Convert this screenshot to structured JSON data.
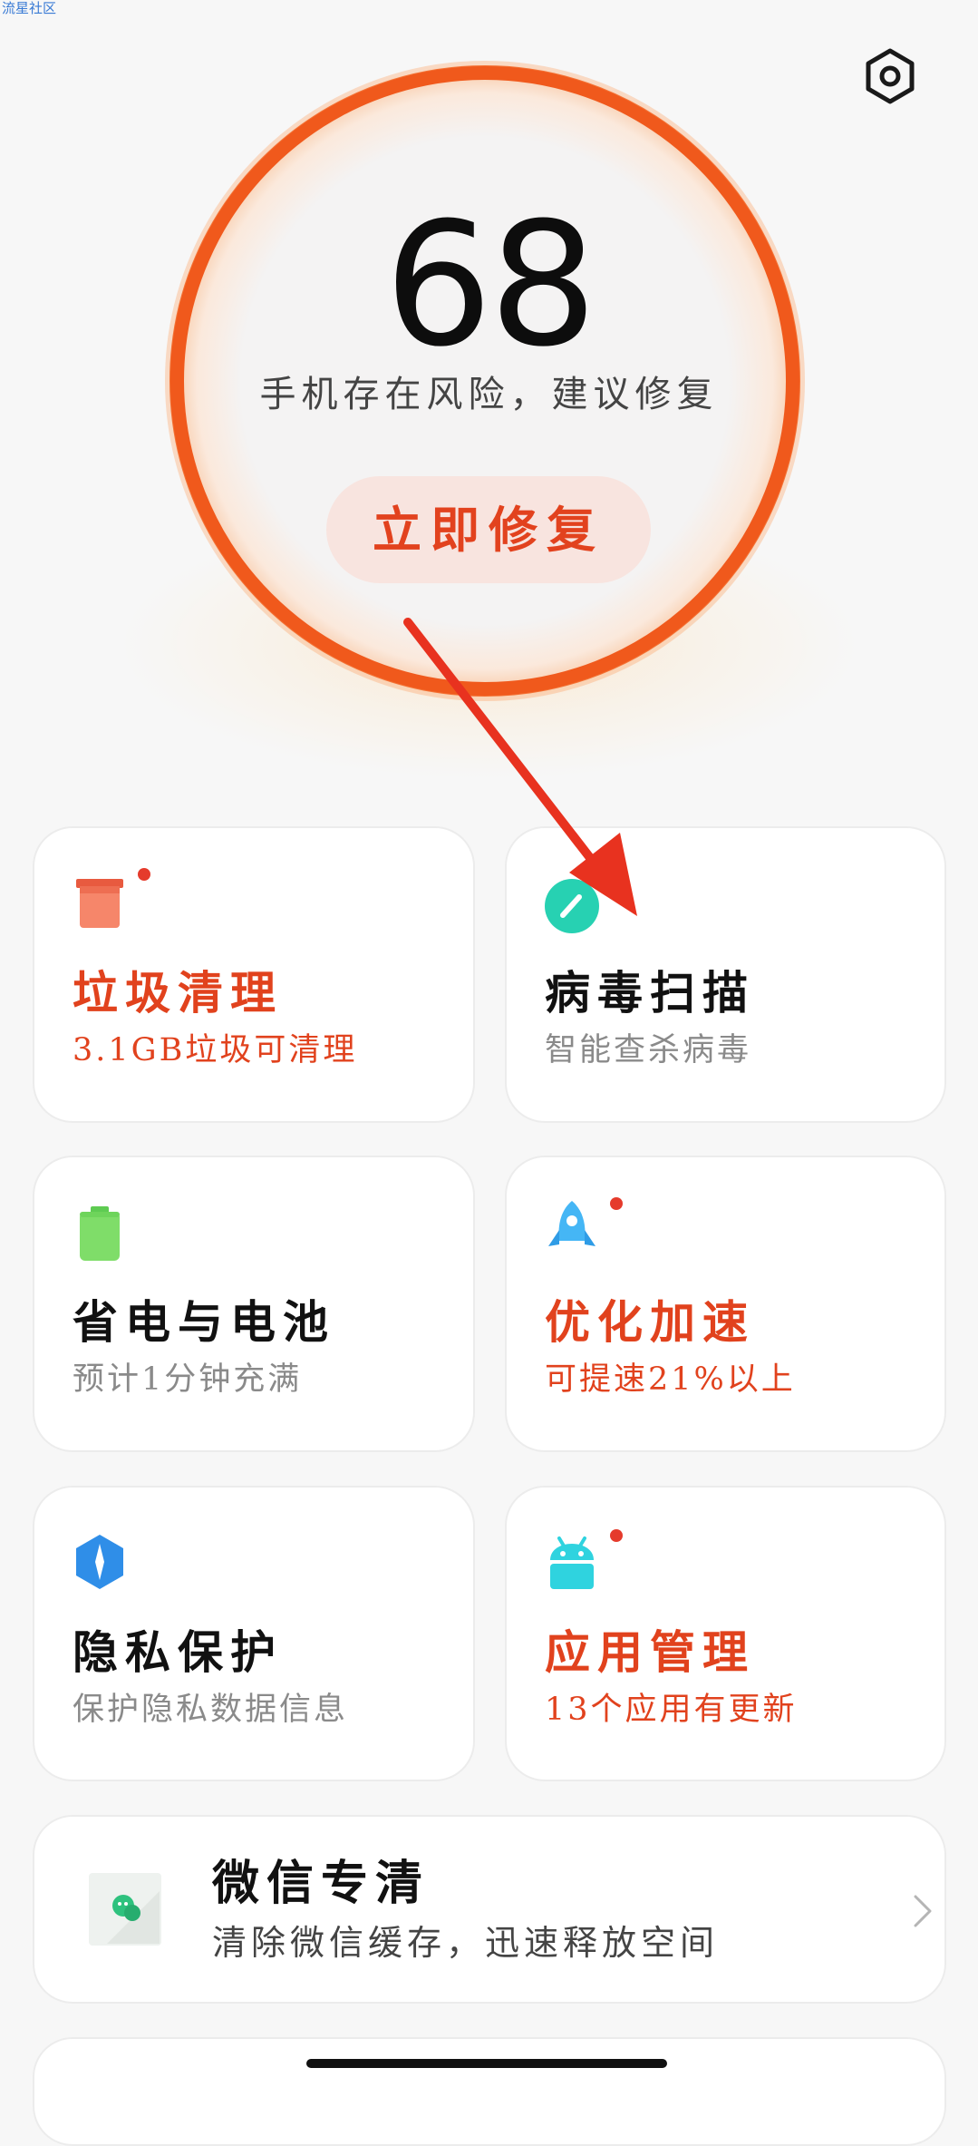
{
  "watermark": "流星社区",
  "settings": {
    "icon": "settings-hexagon-icon"
  },
  "score": {
    "value": "68",
    "status": "手机存在风险，建议修复",
    "fix_button": "立即修复",
    "ring_color": "#f0591c"
  },
  "cards": [
    {
      "title": "垃圾清理",
      "subtitle": "3.1GB垃圾可清理",
      "icon": "trash-bin-icon",
      "badge": true,
      "color": "#e1421d"
    },
    {
      "title": "病毒扫描",
      "subtitle": "智能查杀病毒",
      "icon": "virus-scan-icon",
      "badge": false,
      "color": "#111111"
    },
    {
      "title": "省电与电池",
      "subtitle": "预计1分钟充满",
      "icon": "battery-icon",
      "badge": false,
      "color": "#111111"
    },
    {
      "title": "优化加速",
      "subtitle": "可提速21%以上",
      "icon": "rocket-icon",
      "badge": true,
      "color": "#e1421d"
    },
    {
      "title": "隐私保护",
      "subtitle": "保护隐私数据信息",
      "icon": "privacy-shield-icon",
      "badge": false,
      "color": "#111111"
    },
    {
      "title": "应用管理",
      "subtitle": "13个应用有更新",
      "icon": "app-android-icon",
      "badge": true,
      "color": "#e1421d"
    }
  ],
  "wechat": {
    "title": "微信专清",
    "subtitle": "清除微信缓存，迅速释放空间",
    "icon": "wechat-clean-icon"
  },
  "colors": {
    "accent": "#e1421d",
    "background": "#f7f7f7",
    "card": "#ffffff"
  }
}
